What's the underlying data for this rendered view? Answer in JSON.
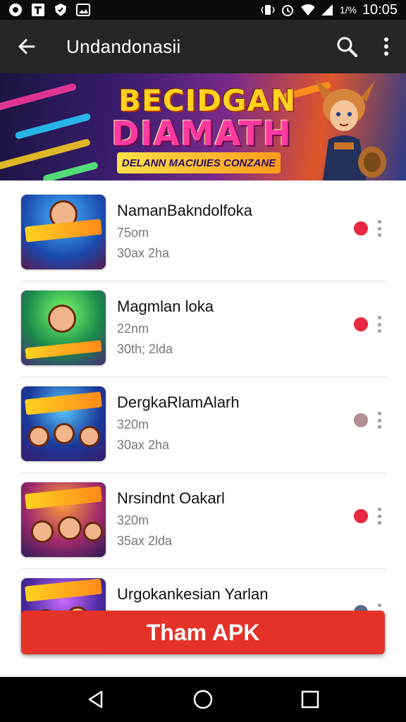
{
  "status_bar": {
    "time": "10:05",
    "battery_text": "1/%",
    "left_icons": [
      "record-icon",
      "notes-icon",
      "shield-icon",
      "image-icon"
    ],
    "right_icons": [
      "vibrate-icon",
      "alarm-icon",
      "wifi-icon",
      "signal-icon"
    ]
  },
  "app_bar": {
    "title": "Undandonasii",
    "back_icon": "arrow-left-icon",
    "search_icon": "search-icon",
    "more_icon": "more-vert-icon"
  },
  "banner": {
    "title_line1": "BECIDGAN",
    "title_line2": "DIAMATH",
    "tagline": "DELANN MACIUIES CONZANE",
    "colors": {
      "title1": "#ffd21f",
      "title2": "#ff3aa0"
    }
  },
  "apps": [
    {
      "title": "NamanBakndolfoka",
      "size": "75om",
      "meta": "30ах 2ha",
      "status_color": "#e8283c"
    },
    {
      "title": "Magmlan loka",
      "size": "22nm",
      "meta": "30th; 2lda",
      "status_color": "#e8283c"
    },
    {
      "title": "DergkaRlamAlarh",
      "size": "320m",
      "meta": "30ах 2ha",
      "status_color": "#b09090"
    },
    {
      "title": "Nrsindnt Oakarl",
      "size": "320m",
      "meta": "35ах 2lda",
      "status_color": "#e8283c"
    },
    {
      "title": "Urgokankesian Yarlan",
      "size": "",
      "meta": "",
      "status_color": "#5a6a8a"
    }
  ],
  "primary_button": {
    "label": "Tham APK",
    "color": "#e53228"
  },
  "nav_bar": {
    "back": "nav-back-icon",
    "home": "nav-home-icon",
    "recents": "nav-recents-icon"
  }
}
